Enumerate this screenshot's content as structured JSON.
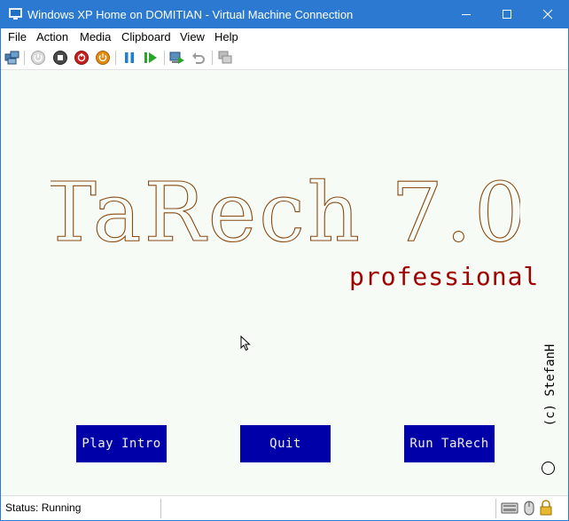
{
  "window": {
    "title": "Windows XP Home on DOMITIAN - Virtual Machine Connection",
    "accent_color": "#2b79d0"
  },
  "menu": {
    "items": [
      "File",
      "Action",
      "Media",
      "Clipboard",
      "View",
      "Help"
    ]
  },
  "toolbar": {
    "icons": [
      "ctrl-alt-del-icon",
      "start-icon",
      "turn-off-icon",
      "shut-down-icon",
      "power-icon",
      "pause-icon",
      "resume-icon",
      "checkpoint-icon",
      "revert-icon",
      "enhanced-session-icon"
    ]
  },
  "vm_screen": {
    "background": "#f6fbf6",
    "logo_title": "TaRech 7.0",
    "logo_subtitle": "professional",
    "copyright": "(c) StefanH",
    "buttons": {
      "play_intro": "Play Intro",
      "quit": "Quit",
      "run_tarech": "Run TaRech"
    },
    "button_color": "#0000a8",
    "logo_color": "#8a4a12",
    "subtitle_color": "#a00000"
  },
  "status": {
    "text": "Status: Running",
    "icons": [
      "keyboard-icon",
      "mouse-icon",
      "lock-icon"
    ]
  }
}
